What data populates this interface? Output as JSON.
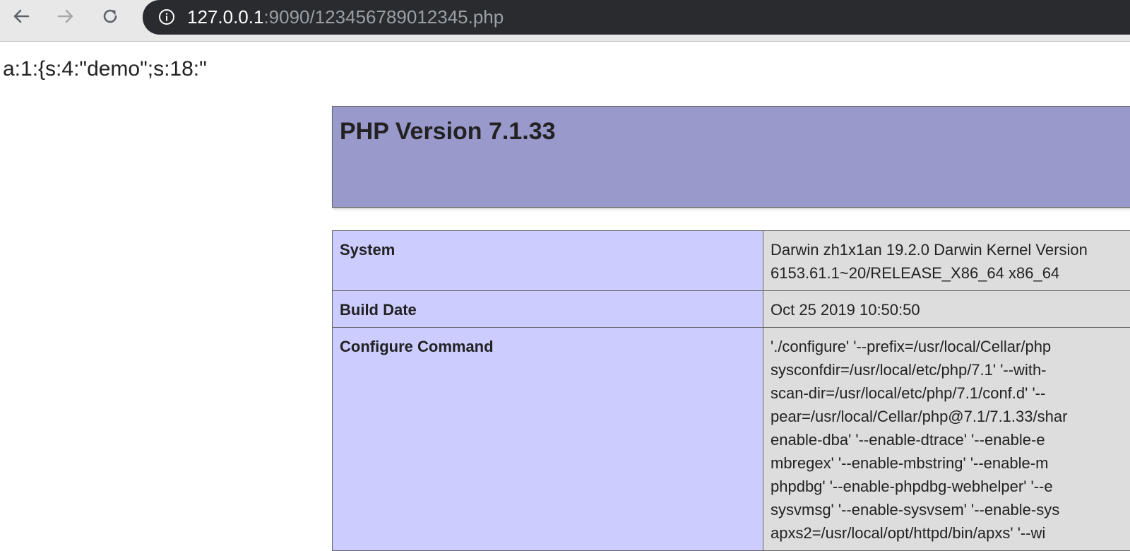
{
  "browser": {
    "url_host": "127.0.0.1",
    "url_rest": ":9090/123456789012345.php"
  },
  "page": {
    "serialized_output": "a:1:{s:4:\"demo\";s:18:\"",
    "header_title": "PHP Version 7.1.33",
    "rows": [
      {
        "key": "System",
        "value": "Darwin zh1x1an 19.2.0 Darwin Kernel Version\n6153.61.1~20/RELEASE_X86_64 x86_64"
      },
      {
        "key": "Build Date",
        "value": "Oct 25 2019 10:50:50"
      },
      {
        "key": "Configure Command",
        "value": "'./configure' '--prefix=/usr/local/Cellar/php\nsysconfdir=/usr/local/etc/php/7.1' '--with-\nscan-dir=/usr/local/etc/php/7.1/conf.d' '--\npear=/usr/local/Cellar/php@7.1/7.1.33/shar\nenable-dba' '--enable-dtrace' '--enable-e\nmbregex' '--enable-mbstring' '--enable-m\nphpdbg' '--enable-phpdbg-webhelper' '--e\nsysvmsg' '--enable-sysvsem' '--enable-sys\napxs2=/usr/local/opt/httpd/bin/apxs' '--wi"
      }
    ]
  }
}
